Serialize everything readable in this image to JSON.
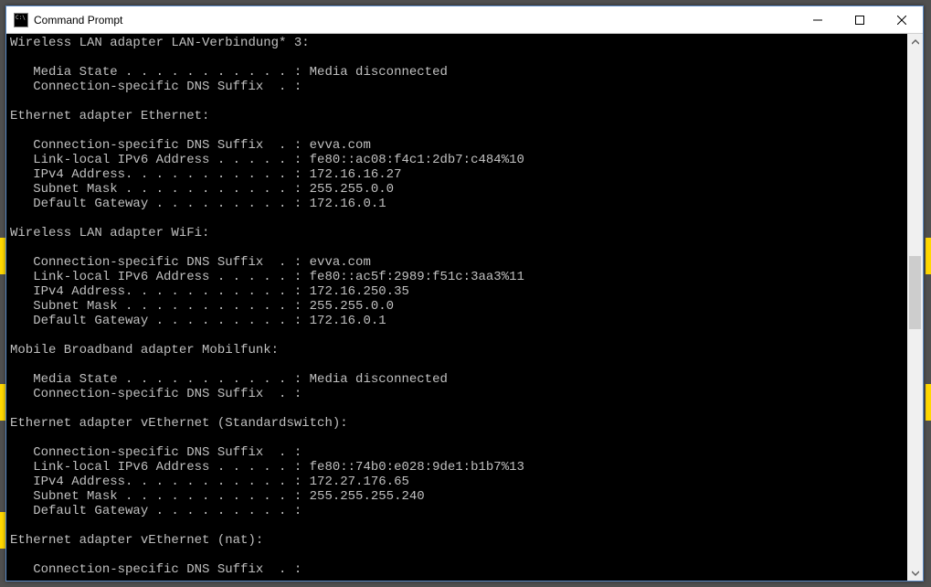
{
  "window": {
    "title": "Command Prompt"
  },
  "console": {
    "lines": [
      "Wireless LAN adapter LAN-Verbindung* 3:",
      "",
      "   Media State . . . . . . . . . . . : Media disconnected",
      "   Connection-specific DNS Suffix  . :",
      "",
      "Ethernet adapter Ethernet:",
      "",
      "   Connection-specific DNS Suffix  . : evva.com",
      "   Link-local IPv6 Address . . . . . : fe80::ac08:f4c1:2db7:c484%10",
      "   IPv4 Address. . . . . . . . . . . : 172.16.16.27",
      "   Subnet Mask . . . . . . . . . . . : 255.255.0.0",
      "   Default Gateway . . . . . . . . . : 172.16.0.1",
      "",
      "Wireless LAN adapter WiFi:",
      "",
      "   Connection-specific DNS Suffix  . : evva.com",
      "   Link-local IPv6 Address . . . . . : fe80::ac5f:2989:f51c:3aa3%11",
      "   IPv4 Address. . . . . . . . . . . : 172.16.250.35",
      "   Subnet Mask . . . . . . . . . . . : 255.255.0.0",
      "   Default Gateway . . . . . . . . . : 172.16.0.1",
      "",
      "Mobile Broadband adapter Mobilfunk:",
      "",
      "   Media State . . . . . . . . . . . : Media disconnected",
      "   Connection-specific DNS Suffix  . :",
      "",
      "Ethernet adapter vEthernet (Standardswitch):",
      "",
      "   Connection-specific DNS Suffix  . :",
      "   Link-local IPv6 Address . . . . . : fe80::74b0:e028:9de1:b1b7%13",
      "   IPv4 Address. . . . . . . . . . . : 172.27.176.65",
      "   Subnet Mask . . . . . . . . . . . : 255.255.255.240",
      "   Default Gateway . . . . . . . . . :",
      "",
      "Ethernet adapter vEthernet (nat):",
      "",
      "   Connection-specific DNS Suffix  . :"
    ]
  }
}
